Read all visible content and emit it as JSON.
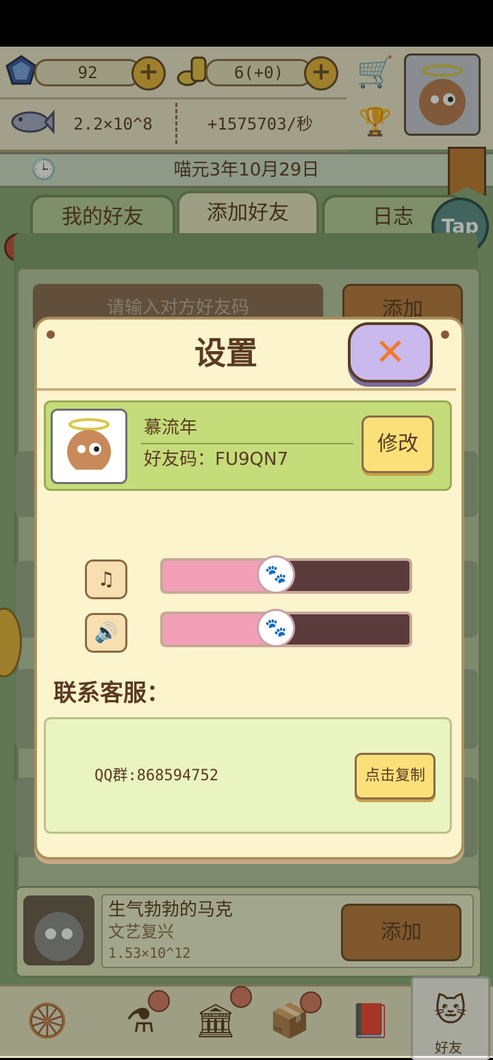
{
  "resources": {
    "gems": "92",
    "coins": "6(+0)",
    "fish_total": "2.2×10^8",
    "fish_rate": "+1575703/秒"
  },
  "date": "喵元3年10月29日",
  "tabs": [
    "我的好友",
    "添加好友",
    "日志"
  ],
  "tap_label": "Tap",
  "search": {
    "placeholder": "请输入对方好友码",
    "add_label": "添加"
  },
  "modal": {
    "title": "设置",
    "nickname": "慕流年",
    "friend_code": "好友码：FU9QN7",
    "edit_label": "修改",
    "music_volume_fraction": 0.45,
    "sound_volume_fraction": 0.45,
    "contact_label": "联系客服：",
    "qq_group": "QQ群:868594752",
    "copy_label": "点击复制"
  },
  "friend": {
    "name": "生气勃勃的马克",
    "era": "文艺复兴",
    "value": "1.53×10^12",
    "add_label": "添加"
  },
  "nav": {
    "friends_label": "好友"
  },
  "colors": {
    "accent_orange": "#f07a2e",
    "slider_fill": "#f2a0b8",
    "profile_green": "#c4dc7a"
  }
}
